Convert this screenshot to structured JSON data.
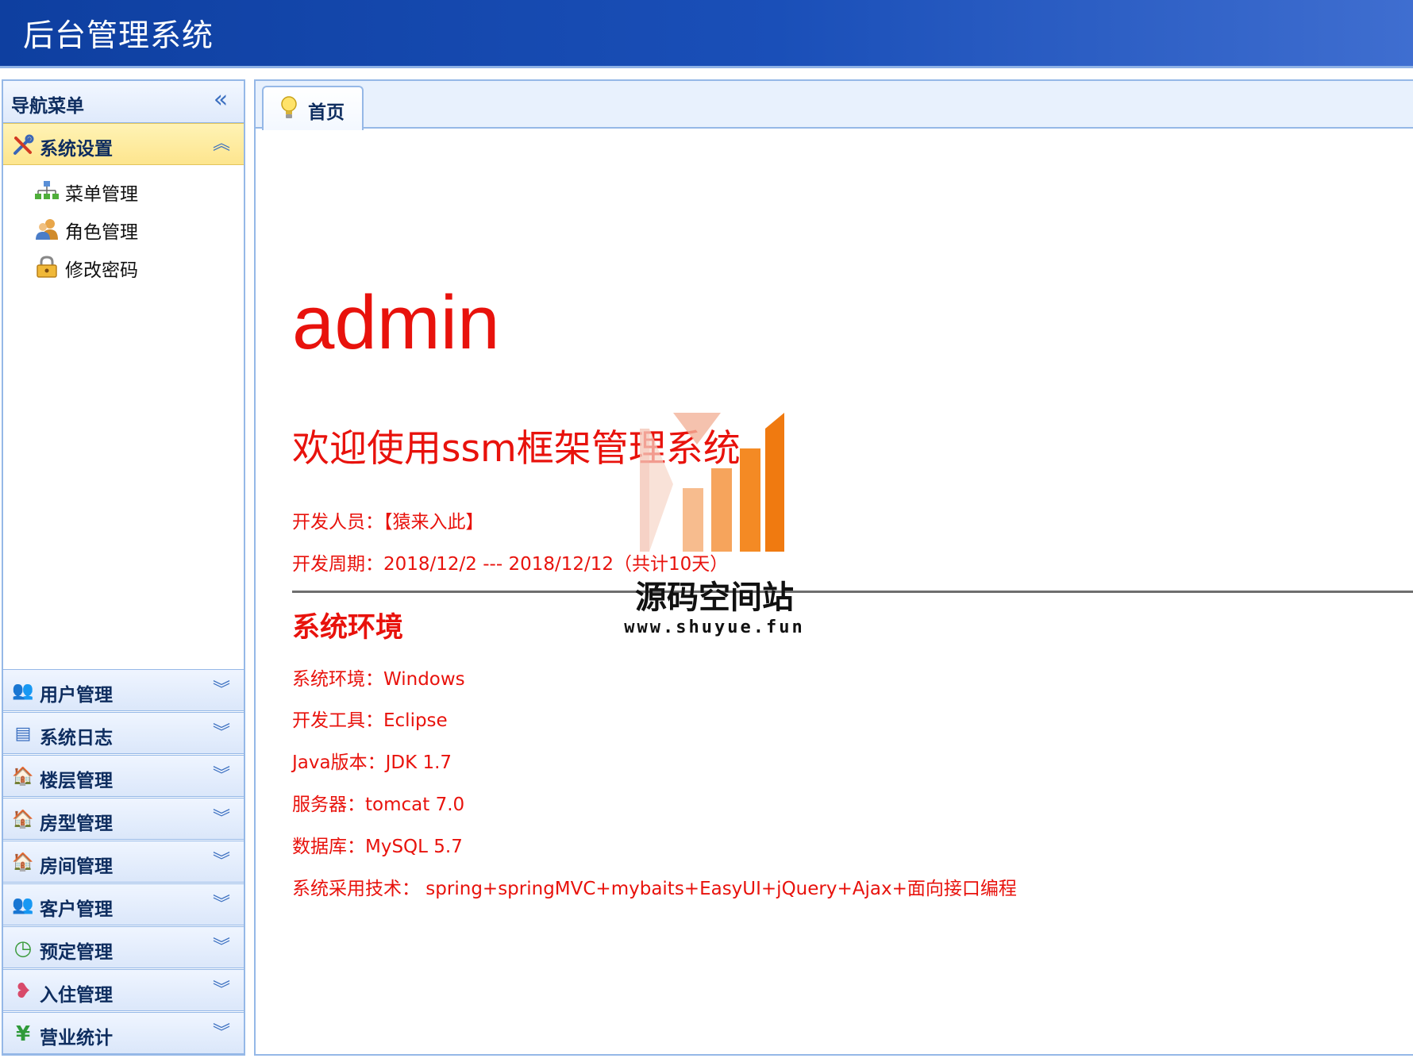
{
  "header": {
    "title": "后台管理系统"
  },
  "sidebar": {
    "title": "导航菜单",
    "collapse_glyph": "«",
    "active_panel": {
      "title": "系统设置",
      "icon": "tools-icon",
      "toggle_glyph": "︽",
      "items": [
        {
          "label": "菜单管理",
          "icon": "sitemap-icon"
        },
        {
          "label": "角色管理",
          "icon": "users-icon"
        },
        {
          "label": "修改密码",
          "icon": "key-lock-icon"
        }
      ]
    },
    "panels": [
      {
        "title": "用户管理",
        "icon": "user-icon",
        "glyph": "👥"
      },
      {
        "title": "系统日志",
        "icon": "log-icon",
        "glyph": "▤"
      },
      {
        "title": "楼层管理",
        "icon": "house-icon",
        "glyph": "🏠"
      },
      {
        "title": "房型管理",
        "icon": "house-icon",
        "glyph": "🏠"
      },
      {
        "title": "房间管理",
        "icon": "house-icon",
        "glyph": "🏠"
      },
      {
        "title": "客户管理",
        "icon": "customers-icon",
        "glyph": "👥"
      },
      {
        "title": "预定管理",
        "icon": "clock-icon",
        "glyph": "◷"
      },
      {
        "title": "入住管理",
        "icon": "checkin-icon",
        "glyph": "❥"
      },
      {
        "title": "营业统计",
        "icon": "yen-icon",
        "glyph": "¥"
      }
    ],
    "expand_glyph": "︾"
  },
  "tabs": [
    {
      "label": "首页",
      "icon": "lightbulb-icon"
    }
  ],
  "content": {
    "admin_name": "admin",
    "welcome": "欢迎使用ssm框架管理系统",
    "developer": "开发人员：【猿来入此】",
    "period": "开发周期：2018/12/2 --- 2018/12/12（共计10天）",
    "env_title": "系统环境",
    "env": [
      "系统环境：Windows",
      "开发工具：Eclipse",
      "Java版本：JDK 1.7",
      "服务器：tomcat 7.0",
      "数据库：MySQL 5.7",
      "系统采用技术： spring+springMVC+mybaits+EasyUI+jQuery+Ajax+面向接口编程"
    ]
  },
  "watermark": {
    "name": "源码空间站",
    "url": "www.shuyue.fun"
  },
  "colors": {
    "header": "#1a4fb8",
    "border": "#95b8e7",
    "active_panel": "#fde58e",
    "content_text": "#e8120c"
  }
}
